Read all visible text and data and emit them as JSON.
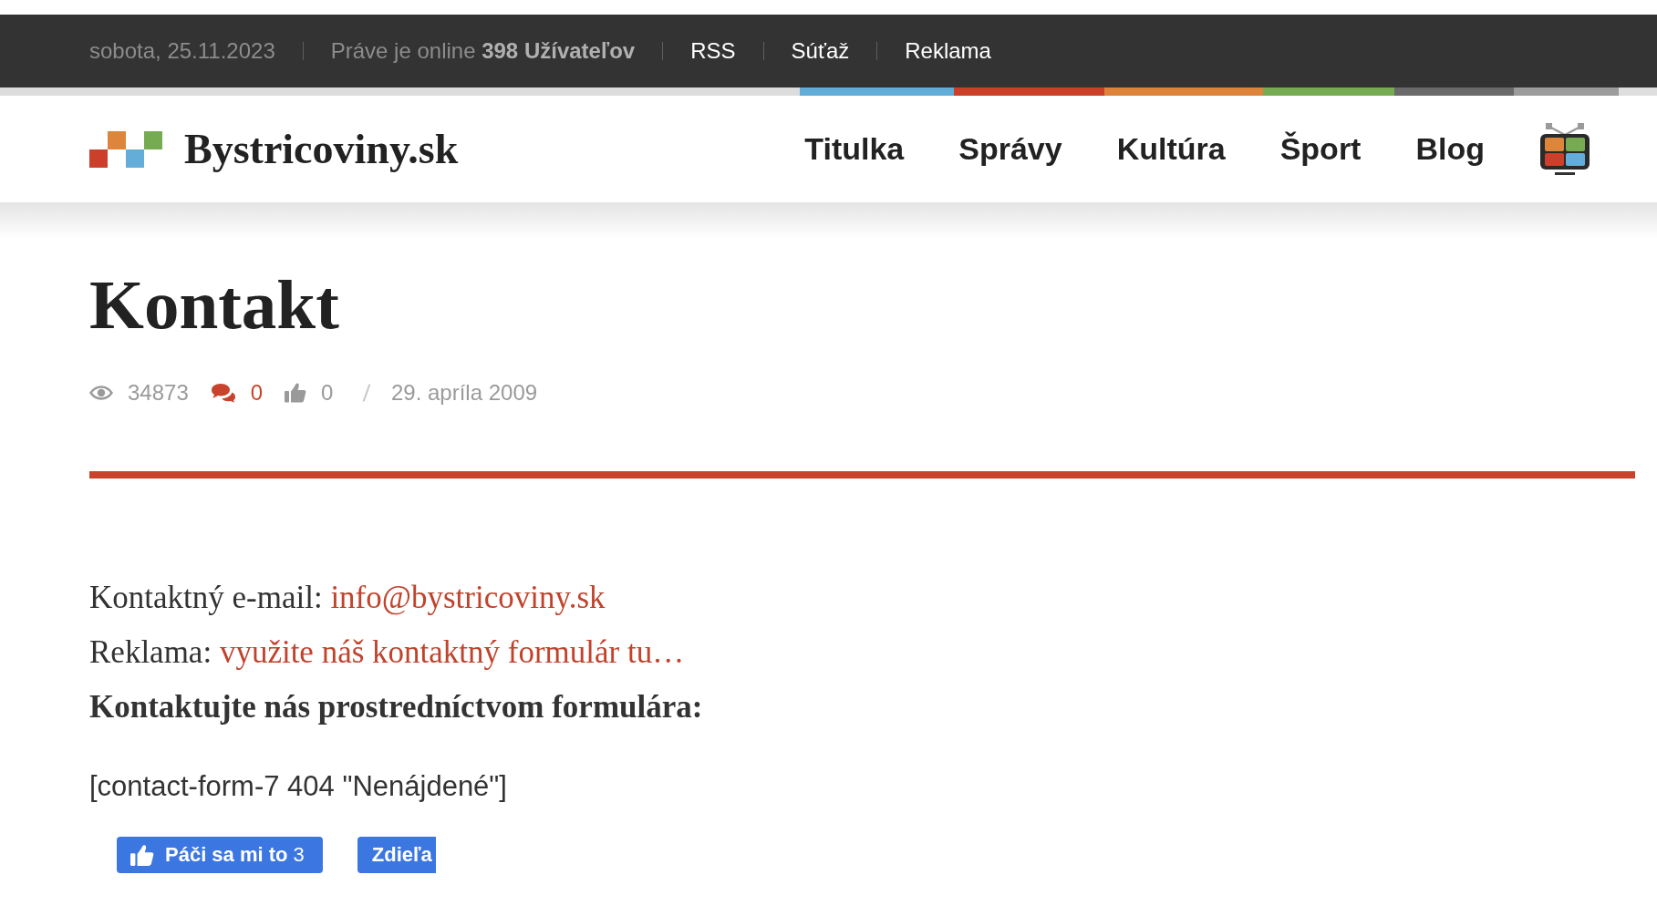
{
  "top_bar": {
    "date": "sobota, 25.11.2023",
    "online": "Práve je online **398 Užívateľov**",
    "links": [
      "RSS",
      "Súťaž",
      "Reklama"
    ]
  },
  "header": {
    "logo_text": "Bystricoviny.sk",
    "nav": [
      "Titulka",
      "Správy",
      "Kultúra",
      "Šport",
      "Blog"
    ]
  },
  "article": {
    "title": "Kontakt",
    "meta": {
      "views": "34873",
      "comments": "0",
      "likes": "0",
      "date": "29. apríla 2009"
    },
    "body": [
      {
        "kind": "link_line",
        "label": "Kontaktný e-mail:",
        "link": "info@bystricoviny.sk"
      },
      {
        "kind": "link_line",
        "label": "Reklama:",
        "link": "využite náš kontaktný formulár tu…"
      },
      {
        "kind": "heading",
        "text": "Kontaktujte nás prostredníctvom formulára:"
      },
      {
        "kind": "shortcode",
        "text": "[contact-form-7 404 \"Nenájdené\"]"
      }
    ]
  },
  "social": {
    "like_button": {
      "label": "Páči sa mi to",
      "count": "3"
    },
    "share_button": {
      "label": "Zdieľa"
    }
  }
}
